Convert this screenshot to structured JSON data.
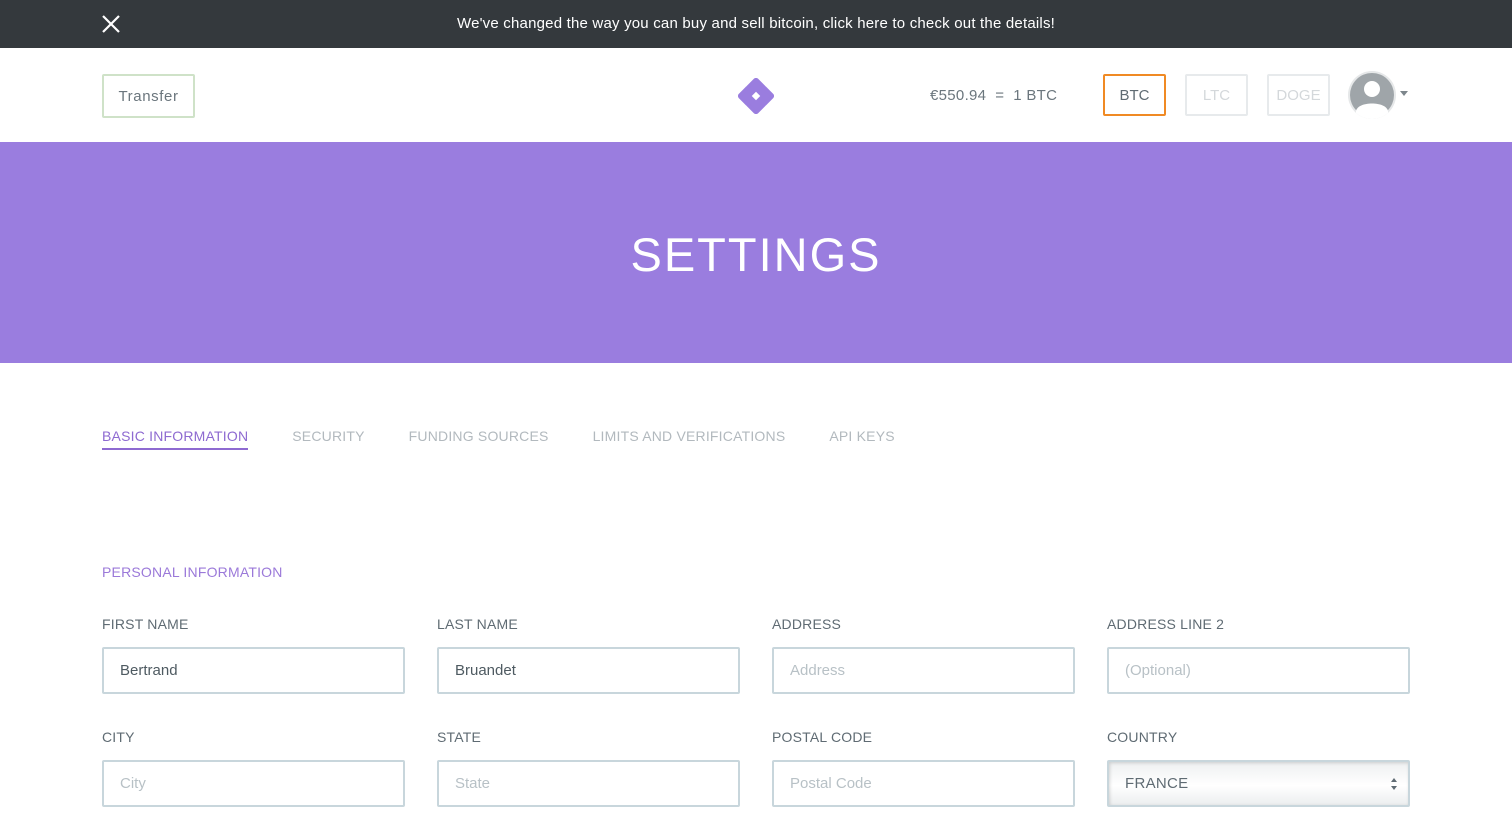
{
  "banner": {
    "text": "We've changed the way you can buy and sell bitcoin, click here to check out the details!",
    "close_icon": "close-icon"
  },
  "header": {
    "transfer_label": "Transfer",
    "logo_icon": "logo-icon",
    "rate_text": "€550.94  =  1 BTC",
    "currencies": [
      {
        "label": "BTC",
        "active": true
      },
      {
        "label": "LTC",
        "active": false
      },
      {
        "label": "DOGE",
        "active": false
      }
    ],
    "avatar_icon": "avatar-icon"
  },
  "hero": {
    "title": "SETTINGS",
    "color": "#9a7ddf"
  },
  "tabs": [
    {
      "label": "BASIC INFORMATION",
      "active": true
    },
    {
      "label": "SECURITY",
      "active": false
    },
    {
      "label": "FUNDING SOURCES",
      "active": false
    },
    {
      "label": "LIMITS AND VERIFICATIONS",
      "active": false
    },
    {
      "label": "API KEYS",
      "active": false
    }
  ],
  "personal": {
    "title": "PERSONAL INFORMATION",
    "fields": {
      "first_name": {
        "label": "FIRST NAME",
        "value": "Bertrand",
        "placeholder": ""
      },
      "last_name": {
        "label": "LAST NAME",
        "value": "Bruandet",
        "placeholder": ""
      },
      "address": {
        "label": "ADDRESS",
        "value": "",
        "placeholder": "Address"
      },
      "address2": {
        "label": "ADDRESS LINE 2",
        "value": "",
        "placeholder": "(Optional)"
      },
      "city": {
        "label": "CITY",
        "value": "",
        "placeholder": "City"
      },
      "state": {
        "label": "STATE",
        "value": "",
        "placeholder": "State"
      },
      "postal": {
        "label": "POSTAL CODE",
        "value": "",
        "placeholder": "Postal Code"
      },
      "country": {
        "label": "COUNTRY",
        "value": "FRANCE"
      }
    }
  },
  "colors": {
    "accent": "#9a7ddf",
    "active_currency": "#f08a24",
    "banner_bg": "#34393d"
  }
}
